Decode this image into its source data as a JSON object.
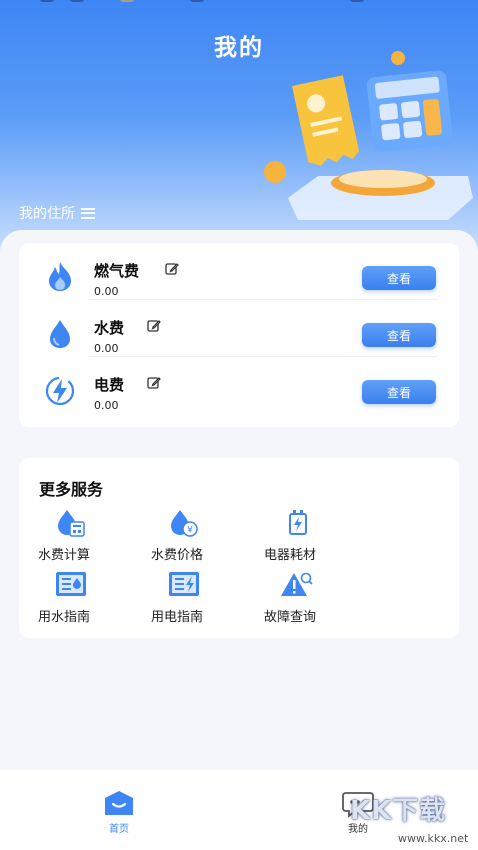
{
  "header": {
    "title": "我的",
    "residence_label": "我的住所"
  },
  "bills": [
    {
      "name": "燃气费",
      "amount": "0.00",
      "button": "查看",
      "icon": "flame-icon"
    },
    {
      "name": "水费",
      "amount": "0.00",
      "button": "查看",
      "icon": "water-drop-icon"
    },
    {
      "name": "电费",
      "amount": "0.00",
      "button": "查看",
      "icon": "lightning-icon"
    }
  ],
  "services": {
    "title": "更多服务",
    "items": [
      {
        "label": "水费计算",
        "icon": "water-calculator-icon"
      },
      {
        "label": "水费价格",
        "icon": "water-price-icon"
      },
      {
        "label": "电器耗材",
        "icon": "appliance-icon"
      },
      {
        "label": "用水指南",
        "icon": "water-guide-icon"
      },
      {
        "label": "用电指南",
        "icon": "electric-guide-icon"
      },
      {
        "label": "故障查询",
        "icon": "fault-search-icon"
      }
    ]
  },
  "tabbar": [
    {
      "label": "首页",
      "icon": "home-icon",
      "active": true
    },
    {
      "label": "我的",
      "icon": "chat-bubble-icon",
      "active": false
    }
  ],
  "watermark": {
    "text": "KK下载",
    "sub": "www.kkx.net"
  },
  "colors": {
    "primary": "#3b7fee",
    "hero_top": "#3f86f5",
    "background": "#f4f6fb"
  }
}
